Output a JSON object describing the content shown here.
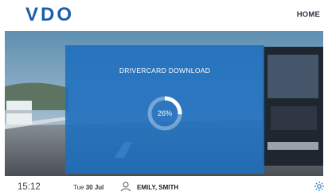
{
  "header": {
    "logo_text": "VDO",
    "home_label": "HOME"
  },
  "card": {
    "title": "DRIVERCARD DOWNLOAD",
    "progress_percent": 26,
    "progress_label": "26%"
  },
  "footer": {
    "time": "15:12",
    "day": "Tue",
    "date": "30 Jul",
    "user_name": "EMILY, SMITH"
  },
  "colors": {
    "brand_blue": "#1a5fae",
    "card_blue": "#1e6ebe",
    "accent_blue": "#2b7bd0"
  }
}
